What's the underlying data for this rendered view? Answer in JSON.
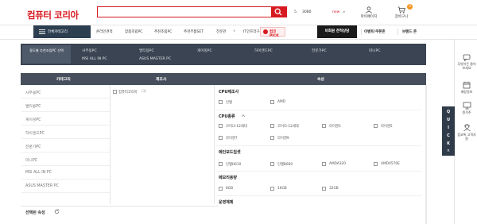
{
  "header": {
    "logo": "컴퓨터 코리아",
    "search_placeholder": "",
    "hot_rank": "5.",
    "hot_keyword": "3080",
    "new_tag": "new",
    "new_caret": "▸",
    "links": [
      {
        "label": "마이페이지",
        "icon": "user-icon"
      },
      {
        "label": "장바구니",
        "icon": "cart-icon",
        "badge": "0"
      }
    ]
  },
  "nav": {
    "all_category": "전체카테고리",
    "items": [
      "온라인견적",
      "맞춤조립PC",
      "추천조립PC",
      "추천부품SET",
      "전문관",
      "IT인프라구축"
    ],
    "dropdown_caret": "∨",
    "pick_label": "컴코PICK",
    "consult_button": "비회원 견적상담",
    "event_link": "이벤트/쿠폰존",
    "brand_link": "브랜드 존"
  },
  "category_panel": {
    "left_label": "용도별 추천조립PC 선택",
    "links": [
      "사무용PC",
      "멀티용PC",
      "게이밍PC",
      "하이엔드PC",
      "전문가PC",
      "미니PC",
      "MSI ALL IN PC",
      "ASUS MASTER PC"
    ]
  },
  "table": {
    "headers": {
      "category": "카테고리",
      "maker": "제조사",
      "attribute": "속성"
    },
    "categories": [
      "사무용PC",
      "멀티용PC",
      "게이밍PC",
      "하이엔드PC",
      "전문가PC",
      "미니PC",
      "MSI ALL IN PC",
      "ASUS MASTER PC"
    ],
    "maker": {
      "label": "컴퓨터코리아",
      "count": "(3)"
    },
    "groups": [
      {
        "title": "CPU제조사",
        "options": [
          "인텔",
          "AMD"
        ]
      },
      {
        "title": "CPU종류",
        "options": [
          "코어i3-12세대",
          "코어i5-12세대",
          "라이젠3",
          "라이젠5",
          "라이젠7",
          "라이젠9"
        ]
      },
      {
        "title": "메인보드칩셋",
        "options": [
          "인텔H610",
          "인텔B660",
          "AMDA320",
          "AMDX570E"
        ]
      },
      {
        "title": "메모리용량",
        "options": [
          "8GB",
          "16GB",
          "32GB"
        ]
      },
      {
        "title": "운영체제",
        "options": []
      }
    ]
  },
  "selected_bar": {
    "label": "선택된 속성"
  },
  "right_sidebar": {
    "items": [
      {
        "label": "무엇이든 물어보세요",
        "icon": "chat-icon"
      },
      {
        "label": "매장정보",
        "icon": "calendar-icon"
      },
      {
        "label": "원격주",
        "icon": "monitor-icon"
      },
      {
        "label": "컴코톡 고객지원",
        "icon": "support-icon"
      }
    ],
    "quick_letters": [
      "Q",
      "U",
      "I",
      "C",
      "K"
    ],
    "quick_close": "×"
  },
  "colors": {
    "brand_red": "#d71920",
    "nav_dark": "#2c3e50",
    "panel_dark": "#3a4452",
    "badge_orange": "#f7931e"
  }
}
